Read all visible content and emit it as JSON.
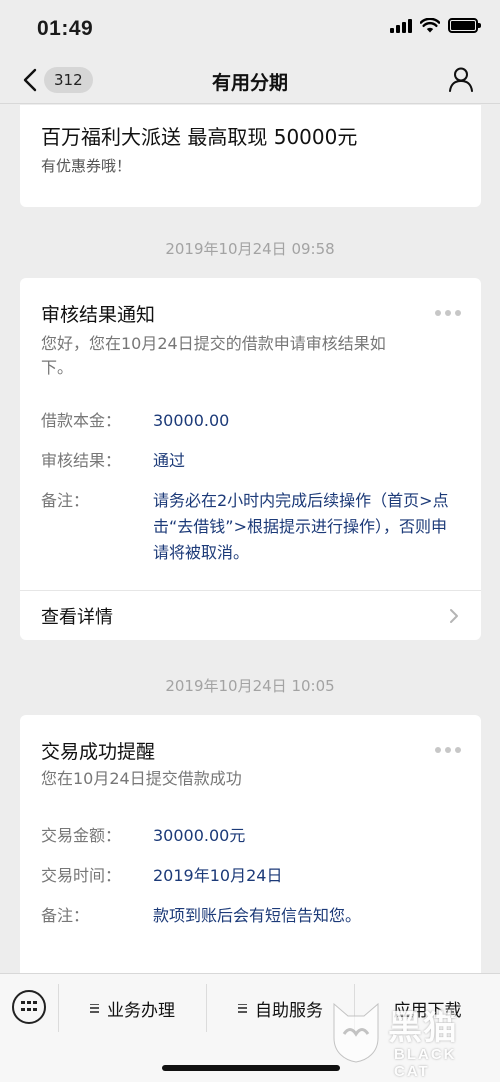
{
  "status_bar": {
    "time": "01:49",
    "icons": [
      "signal-icon",
      "wifi-icon",
      "battery-icon"
    ]
  },
  "nav": {
    "back_count": "312",
    "title": "有用分期",
    "icons": [
      "back-chevron-icon",
      "user-icon"
    ]
  },
  "promo": {
    "title": "百万福利大派送 最高取现 50000元",
    "subtitle": "有优惠券哦！"
  },
  "messages": [
    {
      "timestamp": "2019年10月24日 09:58",
      "title": "审核结果通知",
      "description": "您好，您在10月24日提交的借款申请审核结果如下。",
      "rows": [
        {
          "label": "借款本金：",
          "value": "30000.00"
        },
        {
          "label": "审核结果：",
          "value": "通过"
        },
        {
          "label": "备注：",
          "value": "请务必在2小时内完成后续操作（首页>点击“去借钱”>根据提示进行操作），否则申请将被取消。"
        }
      ],
      "link_label": "查看详情"
    },
    {
      "timestamp": "2019年10月24日 10:05",
      "title": "交易成功提醒",
      "description": "您在10月24日提交借款成功",
      "rows": [
        {
          "label": "交易金额：",
          "value": "30000.00元"
        },
        {
          "label": "交易时间：",
          "value": "2019年10月24日"
        },
        {
          "label": "备注：",
          "value": "款项到账后会有短信告知您。"
        }
      ]
    }
  ],
  "bottom_menu": {
    "items": [
      {
        "label": "业务办理"
      },
      {
        "label": "自助服务"
      },
      {
        "label": "应用下载"
      }
    ],
    "icons": [
      "keyboard-icon",
      "menu-lines-icon"
    ]
  },
  "watermark": {
    "text_cn": "黑猫",
    "text_en": "BLACK CAT"
  },
  "colors": {
    "background": "#ededed",
    "card": "#ffffff",
    "value_text": "#1c3a78",
    "muted_text": "#777777"
  }
}
